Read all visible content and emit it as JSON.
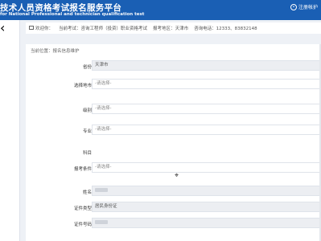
{
  "header": {
    "title": "技术人员资格考试报名服务平台",
    "subtitle": "for National Professional and technician qualification test",
    "user_link": "注册帐护"
  },
  "infobar": {
    "welcome": "欢迎你：",
    "exam_label": "当前考试：",
    "exam_value": "咨询工程师（投资）职业资格考试",
    "region_label": "报考地区：",
    "region_value": "天津市",
    "phone_label": "咨询电话：",
    "phone_value": "12333、83832148"
  },
  "breadcrumb": "当前位置：报名信息维护",
  "form": {
    "rows": [
      {
        "label": "省份",
        "value": "天津市",
        "style": "gray"
      },
      {
        "label": "选择地市",
        "value": "-请选择-",
        "style": "select"
      },
      {
        "label": "级别",
        "value": "-请选择-",
        "style": "select"
      },
      {
        "label": "专业",
        "value": "-请选择-",
        "style": "select"
      },
      {
        "label": "科目",
        "value": "",
        "style": "none"
      },
      {
        "label": "报考条件",
        "value": "-请选择-",
        "style": "select"
      },
      {
        "label": "姓名",
        "value": "",
        "style": "blurred"
      },
      {
        "label": "证件类型",
        "value": "居民身份证",
        "style": "gray"
      },
      {
        "label": "证件号码",
        "value": "",
        "style": "blurred"
      }
    ]
  }
}
